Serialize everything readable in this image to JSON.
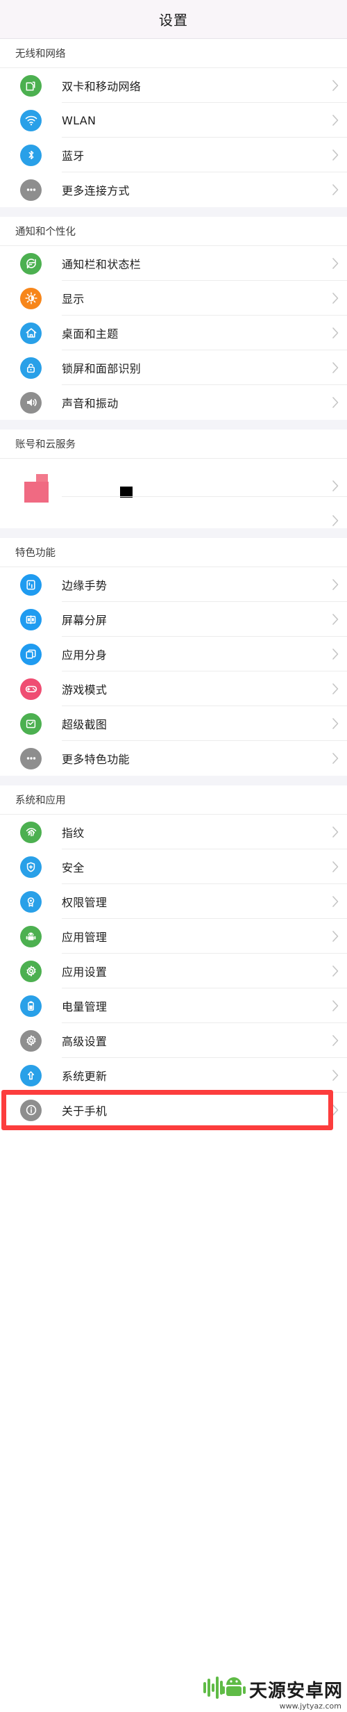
{
  "header": {
    "title": "设置"
  },
  "colors": {
    "header_bg": "#f9f5f9",
    "group_bg": "#f4f4f8",
    "row_bg": "#ffffff",
    "divider": "#ececec",
    "chevron": "#c3c3c3",
    "highlight_red": "#fc3d3d",
    "green": "#4cb050",
    "blue": "#29a0e8",
    "grey": "#8e8e8e",
    "orange": "#f7861a",
    "pink": "#ef4d72",
    "light_green": "#62c462"
  },
  "sections": [
    {
      "name": "wireless-and-network",
      "title": "无线和网络",
      "items": [
        {
          "label": "双卡和移动网络",
          "icon": "sim-card-icon",
          "color": "#4cb050"
        },
        {
          "label": "WLAN",
          "icon": "wifi-icon",
          "color": "#29a0e8"
        },
        {
          "label": "蓝牙",
          "icon": "bluetooth-icon",
          "color": "#29a0e8"
        },
        {
          "label": "更多连接方式",
          "icon": "more-dots-icon",
          "color": "#8e8e8e"
        }
      ]
    },
    {
      "name": "notification-and-personalization",
      "title": "通知和个性化",
      "items": [
        {
          "label": "通知栏和状态栏",
          "icon": "chat-bubble-icon",
          "color": "#4cb050"
        },
        {
          "label": "显示",
          "icon": "brightness-icon",
          "color": "#f7861a"
        },
        {
          "label": "桌面和主题",
          "icon": "home-icon",
          "color": "#29a0e8"
        },
        {
          "label": "锁屏和面部识别",
          "icon": "lock-icon",
          "color": "#29a0e8"
        },
        {
          "label": "声音和振动",
          "icon": "speaker-icon",
          "color": "#8e8e8e"
        }
      ]
    },
    {
      "name": "account-and-cloud",
      "title": "账号和云服务",
      "corrupted": true,
      "items": [
        {
          "label": "",
          "icon": "corrupted-icon",
          "color": "#ef4d72"
        },
        {
          "label": "",
          "icon": "corrupted-icon",
          "color": "#fc2b2b"
        }
      ]
    },
    {
      "name": "featured-functions",
      "title": "特色功能",
      "items": [
        {
          "label": "边缘手势",
          "icon": "edge-gesture-icon",
          "color": "#1f9bf0"
        },
        {
          "label": "屏幕分屏",
          "icon": "split-screen-icon",
          "color": "#1f9bf0"
        },
        {
          "label": "应用分身",
          "icon": "app-clone-icon",
          "color": "#1f9bf0"
        },
        {
          "label": "游戏模式",
          "icon": "gamepad-icon",
          "color": "#ef4d72"
        },
        {
          "label": "超级截图",
          "icon": "screenshot-icon",
          "color": "#4cb050"
        },
        {
          "label": "更多特色功能",
          "icon": "more-dots-icon",
          "color": "#8e8e8e"
        }
      ]
    },
    {
      "name": "system-and-apps",
      "title": "系统和应用",
      "items": [
        {
          "label": "指纹",
          "icon": "fingerprint-icon",
          "color": "#4cb050"
        },
        {
          "label": "安全",
          "icon": "shield-plus-icon",
          "color": "#29a0e8"
        },
        {
          "label": "权限管理",
          "icon": "badge-icon",
          "color": "#29a0e8"
        },
        {
          "label": "应用管理",
          "icon": "android-robot-icon",
          "color": "#4cb050"
        },
        {
          "label": "应用设置",
          "icon": "gear-icon",
          "color": "#4cb050"
        },
        {
          "label": "电量管理",
          "icon": "battery-icon",
          "color": "#29a0e8"
        },
        {
          "label": "高级设置",
          "icon": "gear-icon",
          "color": "#8e8e8e"
        },
        {
          "label": "系统更新",
          "icon": "arrow-up-icon",
          "color": "#29a0e8"
        },
        {
          "label": "关于手机",
          "icon": "info-icon",
          "color": "#8e8e8e",
          "highlighted": true
        }
      ]
    }
  ],
  "watermark": {
    "text": "天源安卓网",
    "url": "www.jytyaz.com"
  }
}
